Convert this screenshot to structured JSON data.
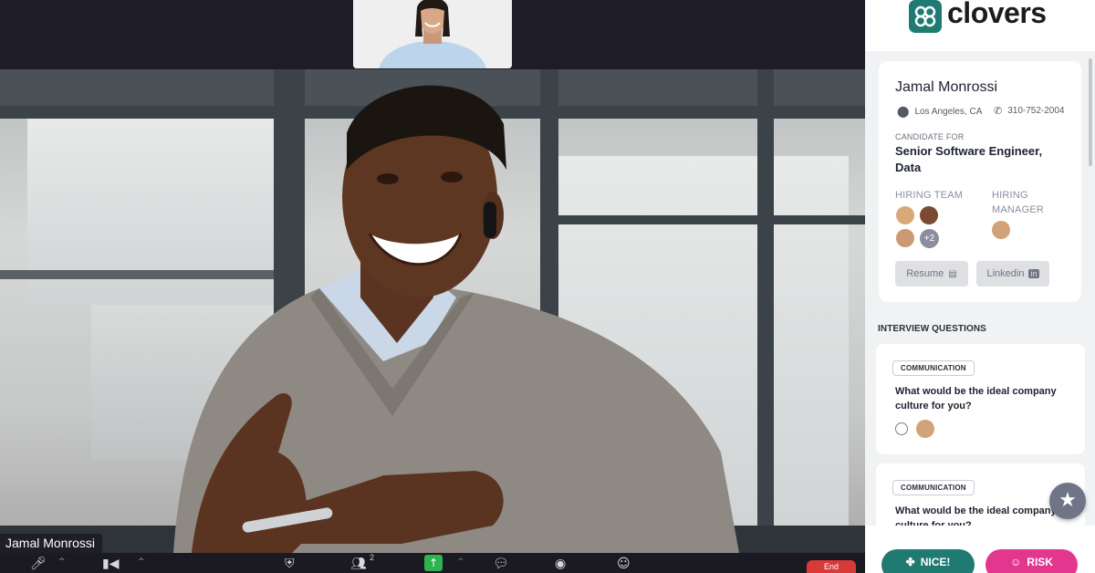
{
  "meeting": {
    "participant_name": "Jamal Monrossi",
    "toolbar": {
      "items": [
        "mic-icon",
        "video-icon",
        "security-icon",
        "participants-icon",
        "share-screen-icon",
        "chat-icon",
        "record-icon",
        "reactions-icon"
      ],
      "participants_count": "2",
      "end_label": "End"
    }
  },
  "panel": {
    "brand": "clovers",
    "candidate": {
      "name": "Jamal Monrossi",
      "location": "Los Angeles, CA",
      "phone": "310-752-2004",
      "candidate_for_label": "CANDIDATE FOR",
      "role": "Senior Software Engineer, Data",
      "hiring_team_label": "HIRING TEAM",
      "hiring_manager_label": "HIRING MANAGER",
      "more_count": "+2",
      "resume_label": "Resume",
      "linkedin_label": "Linkedin"
    },
    "questions_title": "INTERVIEW QUESTIONS",
    "questions": [
      {
        "tag": "COMMUNICATION",
        "text": "What would be the ideal company culture for you?"
      },
      {
        "tag": "COMMUNICATION",
        "text": "What would be the ideal company culture for you?"
      }
    ],
    "actions": {
      "nice_label": "NICE!",
      "risk_label": "RISK"
    },
    "colors": {
      "brand_teal": "#1f7a72",
      "risk_pink": "#e3378f",
      "end_red": "#d83a3a"
    }
  }
}
